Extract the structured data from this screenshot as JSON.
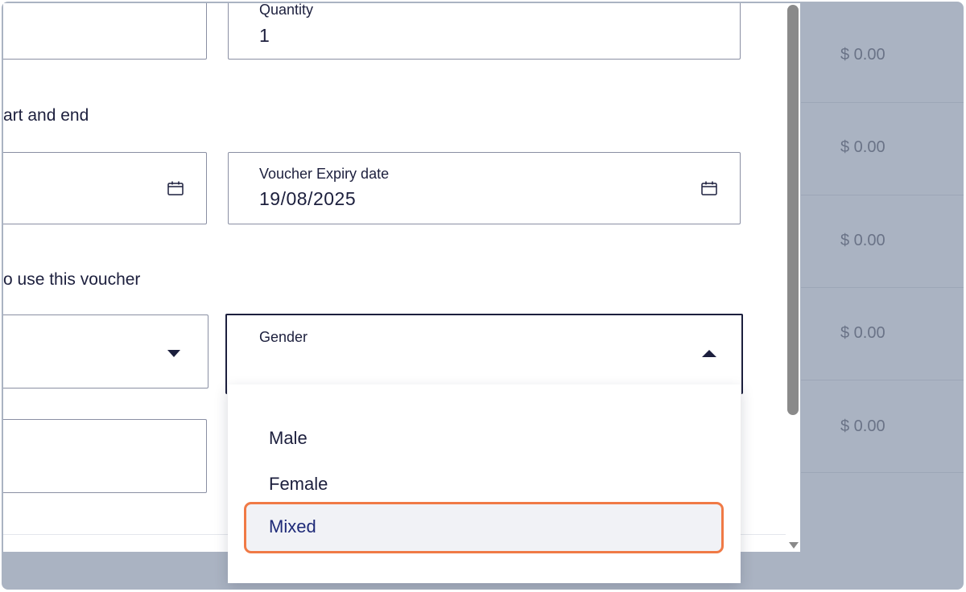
{
  "background_list": {
    "prices": [
      "$ 0.00",
      "$ 0.00",
      "$ 0.00",
      "$ 0.00",
      "$ 0.00"
    ]
  },
  "form": {
    "quantity": {
      "label": "Quantity",
      "value": "1"
    },
    "dates_section_text": "art and end",
    "expiry": {
      "label": "Voucher Expiry date",
      "value": "19/08/2025"
    },
    "eligibility_section_text": "o use this voucher",
    "gender": {
      "label": "Gender",
      "options": [
        "Male",
        "Female",
        "Mixed"
      ],
      "highlighted": "Mixed"
    }
  },
  "colors": {
    "accent_highlight": "#f07a46",
    "text_primary": "#1c1f3d",
    "overlay_bg": "#aab3c2"
  },
  "icons": {
    "calendar": "calendar-icon",
    "dropdown_closed": "caret-down-icon",
    "dropdown_open": "caret-up-icon"
  }
}
